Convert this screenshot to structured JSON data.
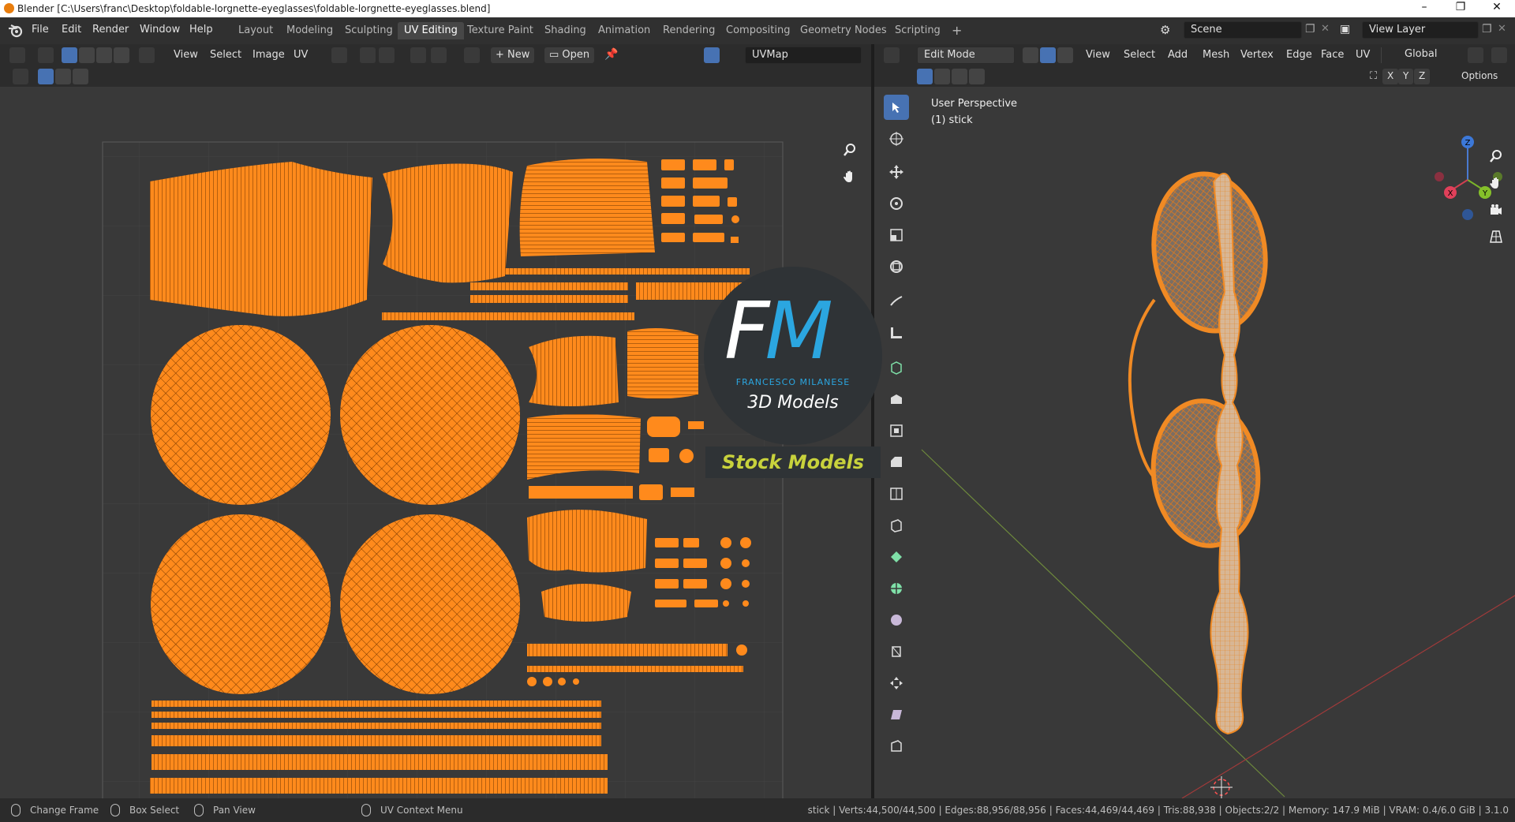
{
  "titlebar": {
    "title": "Blender [C:\\Users\\franc\\Desktop\\foldable-lorgnette-eyeglasses\\foldable-lorgnette-eyeglasses.blend]",
    "minimize": "–",
    "maximize": "❐",
    "close": "✕"
  },
  "menu": [
    "File",
    "Edit",
    "Render",
    "Window",
    "Help"
  ],
  "workspaces": [
    {
      "label": "Layout",
      "active": false
    },
    {
      "label": "Modeling",
      "active": false
    },
    {
      "label": "Sculpting",
      "active": false
    },
    {
      "label": "UV Editing",
      "active": true
    },
    {
      "label": "Texture Paint",
      "active": false
    },
    {
      "label": "Shading",
      "active": false
    },
    {
      "label": "Animation",
      "active": false
    },
    {
      "label": "Rendering",
      "active": false
    },
    {
      "label": "Compositing",
      "active": false
    },
    {
      "label": "Geometry Nodes",
      "active": false
    },
    {
      "label": "Scripting",
      "active": false
    }
  ],
  "add_workspace": "+",
  "scene": {
    "label": "Scene"
  },
  "view_layer": {
    "label": "View Layer"
  },
  "uv_header": {
    "menus": [
      "View",
      "Select",
      "Image",
      "UV"
    ],
    "new_label": "New",
    "open_label": "Open",
    "uvmap": "UVMap"
  },
  "vp_header": {
    "mode": "Edit Mode",
    "menus": [
      "View",
      "Select",
      "Add",
      "Mesh",
      "Vertex",
      "Edge",
      "Face",
      "UV"
    ],
    "orientation": "Global",
    "axes": [
      "X",
      "Y",
      "Z"
    ],
    "options": "Options"
  },
  "viewport": {
    "perspective": "User Perspective",
    "object": "(1) stick"
  },
  "gizmo": {
    "z": "Z",
    "y": "Y",
    "x": "X"
  },
  "watermark": {
    "logo": "FM",
    "company": "FRANCESCO MILANESE",
    "line1": "3D Models",
    "line2": "Stock Models"
  },
  "statusbar": {
    "items": [
      "Change Frame",
      "Box Select",
      "Pan View",
      "UV Context Menu"
    ],
    "stats": "stick | Verts:44,500/44,500 | Edges:88,956/88,956 | Faces:44,469/44,469 | Tris:88,938 | Objects:2/2 | Memory: 147.9 MiB | VRAM: 0.4/6.0 GiB | 3.1.0"
  },
  "colors": {
    "accent": "#4772b3",
    "uv_orange": "#ff8a1c",
    "mesh_orange": "#f08a24",
    "background": "#393939"
  },
  "icons": [
    "blender-logo-icon",
    "editor-type-icon",
    "zoom-icon",
    "hand-pan-icon",
    "camera-icon",
    "grid-icon",
    "select-box-icon",
    "cursor-icon",
    "move-icon",
    "rotate-icon",
    "scale-icon",
    "transform-icon",
    "annotate-icon",
    "measure-icon"
  ]
}
